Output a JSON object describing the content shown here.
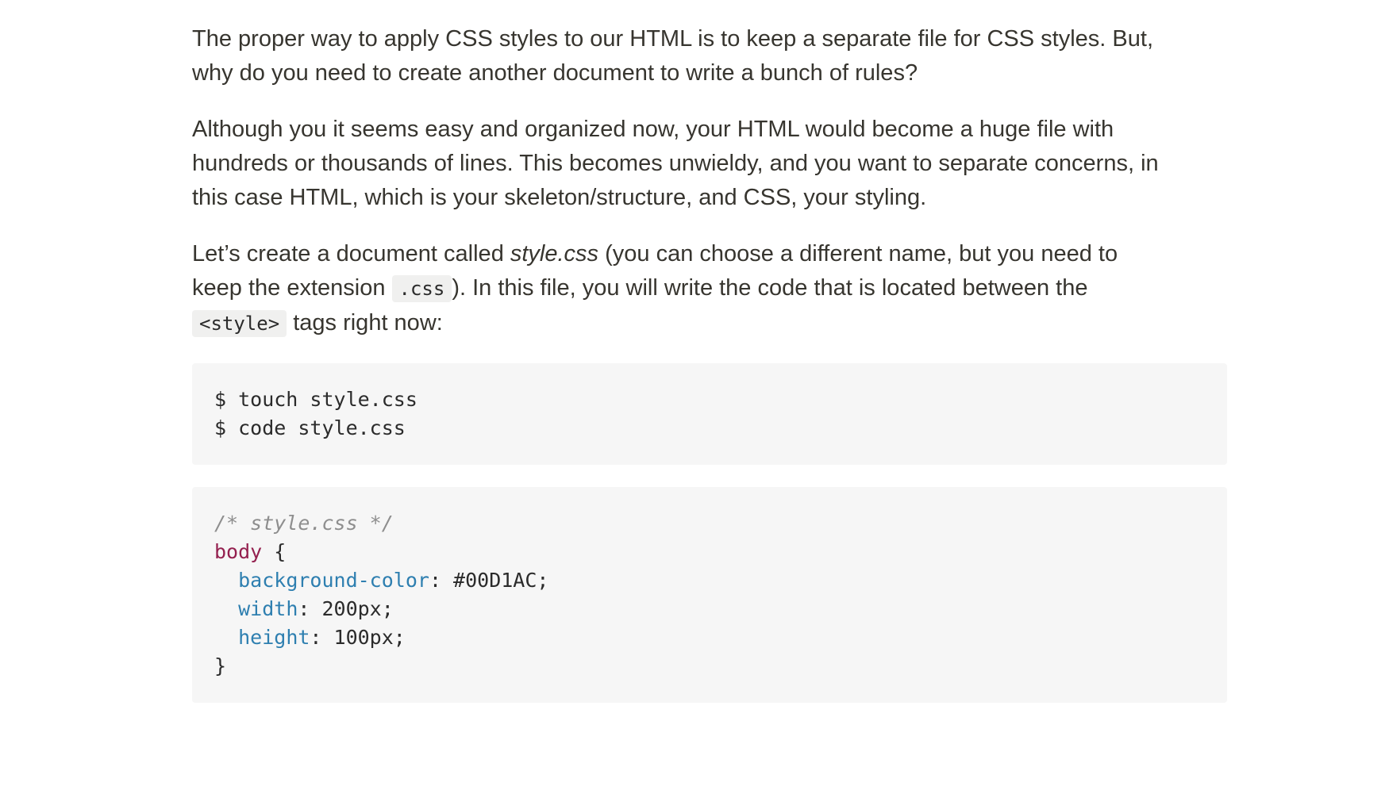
{
  "paragraphs": [
    {
      "lines": [
        "The proper way to apply CSS styles to our HTML is to keep a separate file for CSS styles. But,",
        "why do you need to create another document to write a bunch of rules?"
      ]
    },
    {
      "lines": [
        "Although you it seems easy and organized now, your HTML would become a huge file with",
        "hundreds or thousands of lines. This becomes unwieldy, and you want to separate concerns, in",
        "this case HTML, which is your skeleton/structure, and CSS, your styling."
      ]
    },
    {
      "line1_before": "Let’s create a document called ",
      "line1_em": "style.css",
      "line1_after": " (you can choose a different name, but you need to",
      "line2_before": "keep the extension ",
      "line2_code": ".css",
      "line2_after": "). In this file, you will write the code that is located between the",
      "line3_code": "<style>",
      "line3_after": " tags right now:"
    }
  ],
  "shell_block": {
    "lines": [
      "$ touch style.css",
      "$ code style.css"
    ]
  },
  "css_block": {
    "comment": "/* style.css */",
    "selector": "body",
    "open_brace": " {",
    "declarations": [
      {
        "prop": "background-color",
        "value": ": #00D1AC;"
      },
      {
        "prop": "width",
        "value": ": 200px;"
      },
      {
        "prop": "height",
        "value": ": 100px;"
      }
    ],
    "close_brace": "}",
    "indent": "  "
  },
  "colors": {
    "text": "#37352f",
    "code_background": "#f6f6f6",
    "inline_code_background": "#f0f0ef",
    "comment": "#8e8e8e",
    "selector": "#94204f",
    "property": "#2e7fb0"
  }
}
